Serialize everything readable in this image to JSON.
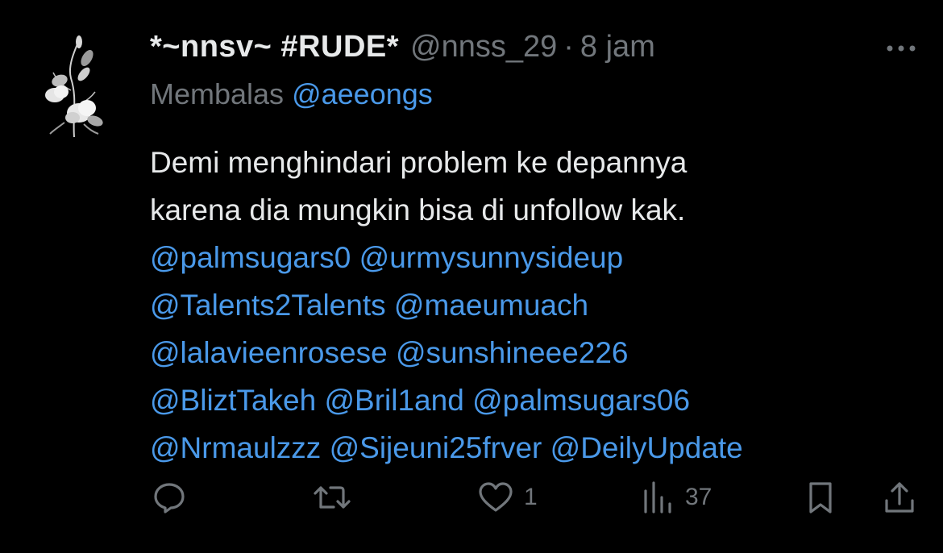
{
  "tweet": {
    "display_name": "*~nnsv~ #RUDE*",
    "handle": "@nnss_29",
    "separator": "·",
    "time": "8 jam",
    "reply_prefix": "Membalas",
    "reply_to": "@aeeongs",
    "text_lines": [
      "Demi menghindari problem ke depannya",
      "karena dia mungkin bisa di unfollow kak."
    ],
    "mention_lines": [
      "@palmsugars0 @urmysunnysideup",
      "@Talents2Talents @maeumuach",
      "@lalavieenrosese @sunshineee226",
      "@BliztTakeh @Bril1and @palmsugars06",
      "@Nrmaulzzz @Sijeuni25frver @DeilyUpdate"
    ]
  },
  "actions": {
    "likes": "1",
    "views": "37"
  },
  "icons": [
    "more-icon",
    "reply-icon",
    "retweet-icon",
    "like-icon",
    "views-icon",
    "bookmark-icon",
    "share-icon"
  ],
  "colors": {
    "background": "#000000",
    "text": "#e7e9ea",
    "muted": "#71767b",
    "link": "#4a99e9"
  }
}
